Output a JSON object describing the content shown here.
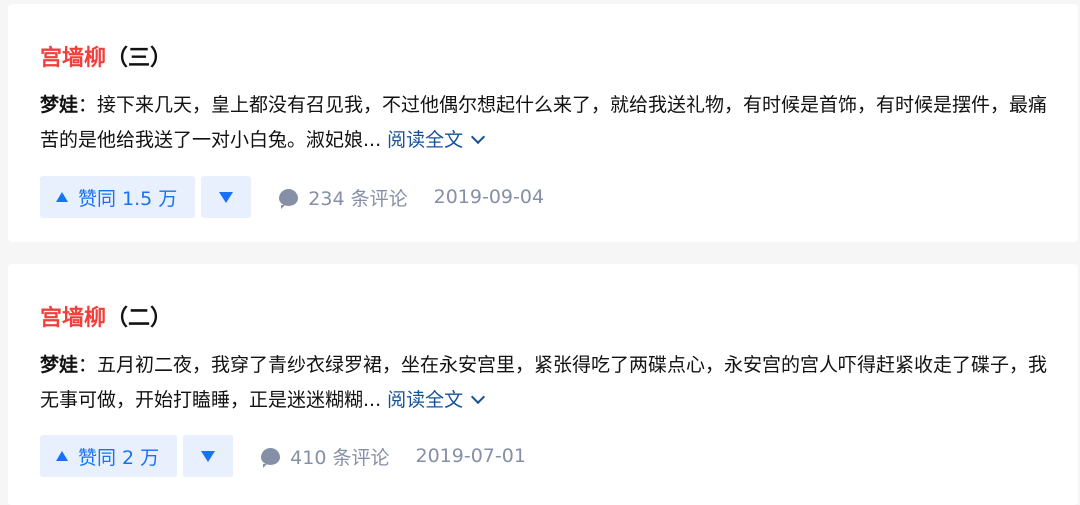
{
  "articles": [
    {
      "title_main": "宫墙柳",
      "title_suffix": "（三）",
      "author": "梦娃",
      "colon": "：",
      "excerpt": "接下来几天，皇上都没有召见我，不过他偶尔想起什么来了，就给我送礼物，有时候是首饰，有时候是摆件，最痛苦的是他给我送了一对小白兔。淑妃娘...",
      "read_more": "阅读全文",
      "upvote_label": "赞同 1.5 万",
      "comments": "234 条评论",
      "date": "2019-09-04"
    },
    {
      "title_main": "宫墙柳",
      "title_suffix": "（二）",
      "author": "梦娃",
      "colon": "：",
      "excerpt": "五月初二夜，我穿了青纱衣绿罗裙，坐在永安宫里，紧张得吃了两碟点心，永安宫的宫人吓得赶紧收走了碟子，我无事可做，开始打瞌睡，正是迷迷糊糊...",
      "read_more": "阅读全文",
      "upvote_label": "赞同 2 万",
      "comments": "410 条评论",
      "date": "2019-07-01"
    }
  ],
  "icons": {
    "upvote": "triangle-up-icon",
    "downvote": "triangle-down-icon",
    "comment": "comment-bubble-icon",
    "expand": "chevron-down-icon"
  },
  "colors": {
    "title_highlight": "#f1403c",
    "link": "#175199",
    "vote": "#1772f6",
    "vote_bg": "#e7f0fc",
    "meta": "#8590a6"
  }
}
